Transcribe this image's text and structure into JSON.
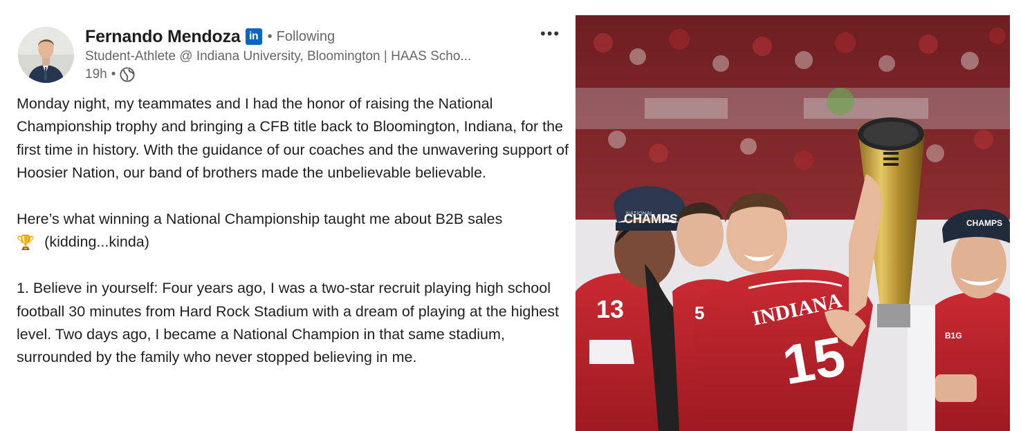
{
  "post": {
    "author": {
      "name": "Fernando Mendoza",
      "badge": "in",
      "follow_status": "Following",
      "headline": "Student-Athlete @ Indiana University, Bloomington | HAAS Scho...",
      "time": "19h",
      "visibility_icon": "globe-icon"
    },
    "menu_icon": "more-horizontal-icon",
    "body": {
      "para1": "Monday night, my teammates and I had the honor of raising the National Championship trophy and bringing a CFB title back to Bloomington, Indiana, for the first time in history. With the guidance of our coaches and the unwavering support of Hoosier Nation, our band of brothers made the unbelievable believable.",
      "para2_text": "Here’s what winning a National Championship taught me about B2B sales",
      "para2_emoji": "🏆",
      "para2_tail": "(kidding...kinda)",
      "para3": "1. Believe in yourself: Four years ago, I was a two-star recruit playing high school football 30 minutes from Hard Rock Stadium with a dream of playing at the highest level. Two days ago, I became a National Champion in that same stadium, surrounded by the family who never stopped believing in me."
    }
  },
  "photo": {
    "cap_text": "CHAMPS",
    "cap_small": "NATIONAL",
    "jersey_left": "13",
    "jersey_center": "15",
    "jersey_text": "INDIANA",
    "sleeve_text": "5",
    "conference": "B1G",
    "colors": {
      "crimson": "#b5202a",
      "crowd": "#7d2a2c",
      "trophy_gold": "#c8a53e",
      "cap_navy": "#1f2a3c",
      "linkedin_blue": "#0a66c2"
    }
  }
}
